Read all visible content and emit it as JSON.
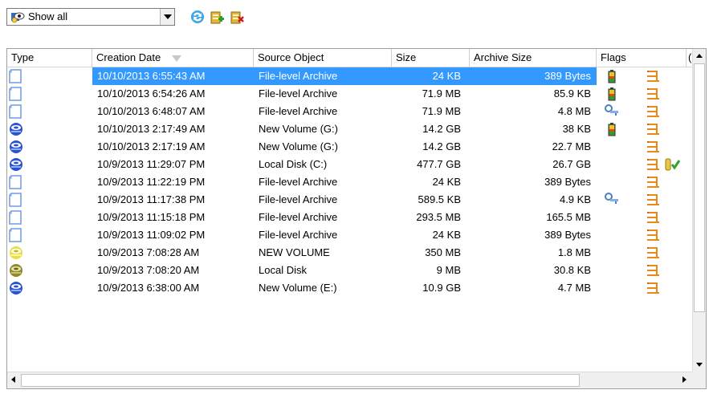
{
  "toolbar": {
    "filter_value": "Show all",
    "icons": [
      "filter-eye-icon",
      "refresh-icon",
      "add-archive-icon",
      "delete-archive-icon"
    ]
  },
  "columns": [
    {
      "key": "type",
      "label": "Type"
    },
    {
      "key": "creation_date",
      "label": "Creation Date",
      "sorted": true
    },
    {
      "key": "source",
      "label": "Source Object"
    },
    {
      "key": "size",
      "label": "Size"
    },
    {
      "key": "archive_size",
      "label": "Archive Size"
    },
    {
      "key": "flags",
      "label": "Flags"
    },
    {
      "key": "more",
      "label": "("
    }
  ],
  "rows": [
    {
      "type_icon": "file-archive-icon",
      "date": "10/10/2013 6:55:43 AM",
      "source": "File-level Archive",
      "size": "24 KB",
      "archive_size": "389 Bytes",
      "flags": [
        "battery-flag-icon",
        "checklist-flag-icon"
      ],
      "selected": true
    },
    {
      "type_icon": "file-archive-icon",
      "date": "10/10/2013 6:54:26 AM",
      "source": "File-level Archive",
      "size": "71.9 MB",
      "archive_size": "85.9 KB",
      "flags": [
        "battery-flag-icon",
        "checklist-flag-icon"
      ]
    },
    {
      "type_icon": "file-archive-icon",
      "date": "10/10/2013 6:48:07 AM",
      "source": "File-level Archive",
      "size": "71.9 MB",
      "archive_size": "4.8 MB",
      "flags": [
        "key-flag-icon",
        "checklist-flag-icon"
      ]
    },
    {
      "type_icon": "volume-archive-icon",
      "date": "10/10/2013 2:17:49 AM",
      "source": "New Volume (G:)",
      "size": "14.2 GB",
      "archive_size": "38 KB",
      "flags": [
        "battery-flag-icon",
        "checklist-flag-icon"
      ]
    },
    {
      "type_icon": "volume-archive-icon",
      "date": "10/10/2013 2:17:19 AM",
      "source": "New Volume (G:)",
      "size": "14.2 GB",
      "archive_size": "22.7 MB",
      "flags": [
        "checklist-flag-icon"
      ]
    },
    {
      "type_icon": "volume-archive-icon",
      "date": "10/9/2013 11:29:07 PM",
      "source": "Local Disk (C:)",
      "size": "477.7 GB",
      "archive_size": "26.7 GB",
      "flags": [
        "checklist-flag-icon",
        "verified-flag-icon"
      ]
    },
    {
      "type_icon": "file-archive-icon",
      "date": "10/9/2013 11:22:19 PM",
      "source": "File-level Archive",
      "size": "24 KB",
      "archive_size": "389 Bytes",
      "flags": [
        "checklist-flag-icon"
      ]
    },
    {
      "type_icon": "file-archive-icon",
      "date": "10/9/2013 11:17:38 PM",
      "source": "File-level Archive",
      "size": "589.5 KB",
      "archive_size": "4.9 KB",
      "flags": [
        "key-flag-icon",
        "checklist-flag-icon"
      ]
    },
    {
      "type_icon": "file-archive-icon",
      "date": "10/9/2013 11:15:18 PM",
      "source": "File-level Archive",
      "size": "293.5 MB",
      "archive_size": "165.5 MB",
      "flags": [
        "checklist-flag-icon"
      ]
    },
    {
      "type_icon": "file-archive-icon",
      "date": "10/9/2013 11:09:02 PM",
      "source": "File-level Archive",
      "size": "24 KB",
      "archive_size": "389 Bytes",
      "flags": [
        "checklist-flag-icon"
      ]
    },
    {
      "type_icon": "yellow-volume-icon",
      "date": "10/9/2013 7:08:28 AM",
      "source": "NEW VOLUME",
      "size": "350 MB",
      "archive_size": "1.8 MB",
      "flags": [
        "checklist-flag-icon"
      ]
    },
    {
      "type_icon": "olive-volume-icon",
      "date": "10/9/2013 7:08:20 AM",
      "source": "Local Disk",
      "size": "9 MB",
      "archive_size": "30.8 KB",
      "flags": [
        "checklist-flag-icon"
      ]
    },
    {
      "type_icon": "volume-archive-icon",
      "date": "10/9/2013 6:38:00 AM",
      "source": "New Volume (E:)",
      "size": "10.9 GB",
      "archive_size": "4.7 MB",
      "flags": [
        "checklist-flag-icon"
      ]
    }
  ],
  "colors": {
    "selection": "#3399ff",
    "file_icon": "#6f9be8",
    "volume_icon": "#2a52d6",
    "flag_orange": "#e88a1a"
  }
}
